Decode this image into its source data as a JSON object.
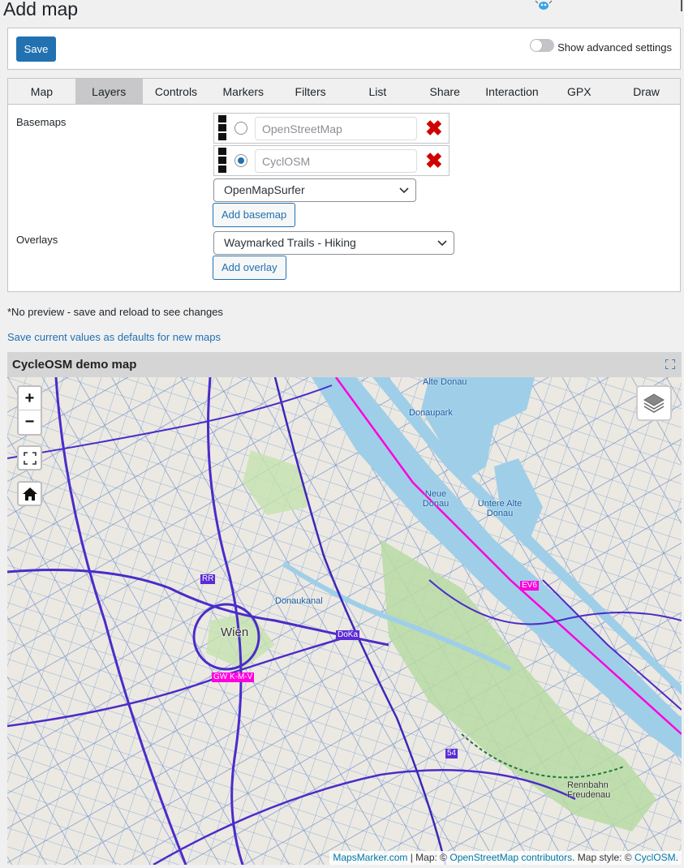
{
  "page": {
    "title": "Add map"
  },
  "toolbar": {
    "save_label": "Save",
    "advanced_label": "Show advanced settings",
    "advanced_enabled": false
  },
  "tabs": [
    {
      "label": "Map",
      "active": false
    },
    {
      "label": "Layers",
      "active": true
    },
    {
      "label": "Controls",
      "active": false
    },
    {
      "label": "Markers",
      "active": false
    },
    {
      "label": "Filters",
      "active": false
    },
    {
      "label": "List",
      "active": false
    },
    {
      "label": "Share",
      "active": false
    },
    {
      "label": "Interaction",
      "active": false
    },
    {
      "label": "GPX",
      "active": false
    },
    {
      "label": "Draw",
      "active": false
    }
  ],
  "layers": {
    "basemaps_label": "Basemaps",
    "basemaps": [
      {
        "name": "OpenStreetMap",
        "selected": false
      },
      {
        "name": "CyclOSM",
        "selected": true
      }
    ],
    "basemap_select": "OpenMapSurfer",
    "add_basemap_label": "Add basemap",
    "overlays_label": "Overlays",
    "overlay_select": "Waymarked Trails - Hiking",
    "add_overlay_label": "Add overlay"
  },
  "notes": {
    "no_preview": "*No preview - save and reload to see changes",
    "save_defaults_link": "Save current values as defaults for new maps"
  },
  "map": {
    "title": "CycleOSM demo map",
    "zoom_in": "+",
    "zoom_out": "−",
    "labels": {
      "city": "Wien",
      "rr": "RR",
      "doka": "DoKa",
      "gw": "GW K-M-V",
      "ev6": "EV6",
      "route54": "54",
      "alte_donau": "Alte Donau",
      "donaupark": "Donaupark",
      "neue_donau": "Neue Donau",
      "untere_alte_donau": "Untere Alte Donau",
      "donaukanal": "Donaukanal",
      "rennbahn": "Rennbahn Freudenau"
    },
    "attribution": {
      "mapsmarker": "MapsMarker.com",
      "sep1": " | Map: © ",
      "osm": "OpenStreetMap contributors",
      "sep2": ". Map style: © ",
      "cyclosm": "CyclOSM",
      "end": "."
    }
  },
  "colors": {
    "accent": "#2271b1",
    "delete": "#d10000",
    "water": "#9fcfe8",
    "route_purple": "#5b2bd6",
    "route_pink": "#ff00dd"
  }
}
